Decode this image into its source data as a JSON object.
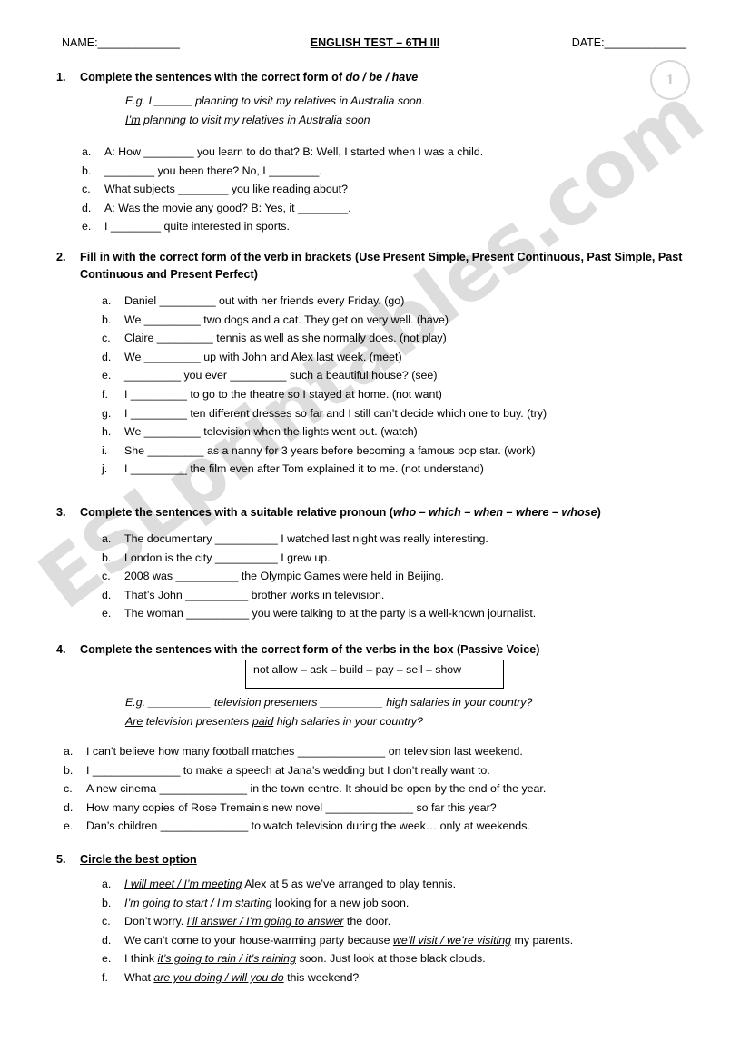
{
  "document": {
    "watermark": "ESLprintables.com",
    "page_badge": "1"
  },
  "header": {
    "name_label": "NAME:",
    "name_blank": "_____________",
    "title": "ENGLISH TEST – 6TH III",
    "date_label": "DATE:",
    "date_blank": "_____________"
  },
  "exercises": [
    {
      "number": "1.",
      "title_pre": "Complete the sentences with the correct form of ",
      "title_italic": "do / be / have",
      "example_prompt": "E.g. I ______ planning to visit my relatives in Australia soon.",
      "example_answer_underlined": "I’m",
      "example_answer_rest": " planning to visit my relatives in Australia soon",
      "items": [
        {
          "label": "a.",
          "text": "A: How ________ you learn to do that?       B: Well, I started when I was a child."
        },
        {
          "label": "b.",
          "text": "________ you been there? No, I ________."
        },
        {
          "label": "c.",
          "text": "What subjects ________ you like reading about?"
        },
        {
          "label": "d.",
          "text": "A: Was the movie any good?          B: Yes, it ________."
        },
        {
          "label": "e.",
          "text": "I ________ quite interested in sports."
        }
      ]
    },
    {
      "number": "2.",
      "title_pre": "Fill in with the correct form of the verb in brackets (Use Present Simple, Present Continuous, Past Simple, Past Continuous and Present Perfect)",
      "title_italic": "",
      "items": [
        {
          "label": "a.",
          "text": "Daniel _________ out with her friends every Friday. (go)"
        },
        {
          "label": "b.",
          "text": "We _________ two dogs and a cat. They get on very well. (have)"
        },
        {
          "label": "c.",
          "text": "Claire _________ tennis as well as she normally does. (not play)"
        },
        {
          "label": "d.",
          "text": "We _________ up with John and Alex last week. (meet)"
        },
        {
          "label": "e.",
          "text": "_________ you ever _________ such a beautiful house? (see)"
        },
        {
          "label": "f.",
          "text": "I _________ to go to the theatre so I stayed at home. (not want)"
        },
        {
          "label": "g.",
          "text": "I _________ ten different dresses so far and I still can’t decide which one to buy. (try)"
        },
        {
          "label": "h.",
          "text": "We _________ television when the lights went out. (watch)"
        },
        {
          "label": "i.",
          "text": "She _________ as a nanny for 3 years before becoming a famous pop star. (work)"
        },
        {
          "label": "j.",
          "text": "I _________ the film even after Tom explained it to me. (not understand)"
        }
      ]
    },
    {
      "number": "3.",
      "title_pre": "Complete the sentences with a suitable relative pronoun (",
      "title_italic": "who – which – when – where – whose",
      "title_post": ")",
      "items": [
        {
          "label": "a.",
          "text": "The documentary __________ I watched last night was really interesting."
        },
        {
          "label": "b.",
          "text": "London is the city __________ I grew up."
        },
        {
          "label": "c.",
          "text": "2008 was __________ the Olympic Games were held in Beijing."
        },
        {
          "label": "d.",
          "text": "That’s John __________ brother works in television."
        },
        {
          "label": "e.",
          "text": "The woman __________ you were talking to at the party is a well-known journalist."
        }
      ]
    },
    {
      "number": "4.",
      "title_pre": "Complete the sentences with the correct form of the verbs in the box (Passive Voice)",
      "title_italic": "",
      "verb_box": {
        "before_strike": "not allow – ask – build – ",
        "strike_word": "pay",
        "after_strike": " – sell – show"
      },
      "example_prompt": "E.g. __________ television presenters __________ high salaries in your country?",
      "example_answer_a": "Are",
      "example_answer_mid": " television presenters ",
      "example_answer_b": "paid",
      "example_answer_end": " high salaries in your country?",
      "items": [
        {
          "label": "a.",
          "text": "I can’t believe how many football matches ______________ on television last weekend."
        },
        {
          "label": "b.",
          "text": "I ______________ to make a speech at Jana’s wedding but I don’t really want to."
        },
        {
          "label": "c.",
          "text": "A new cinema ______________ in the town centre. It should be open by the end of the year."
        },
        {
          "label": "d.",
          "text": "How many copies of Rose Tremain’s new novel ______________ so far this year?"
        },
        {
          "label": "e.",
          "text": "Dan’s children ______________ to watch television during the week… only at weekends."
        }
      ]
    },
    {
      "number": "5.",
      "title_pre": "Circle the best option",
      "title_italic": "",
      "items": [
        {
          "label": "a.",
          "pre": "",
          "option": "I will meet / I’m meeting",
          "post": " Alex at 5 as we’ve arranged to play tennis."
        },
        {
          "label": "b.",
          "pre": "",
          "option": "I’m going to start / I’m starting",
          "post": " looking for a new job soon."
        },
        {
          "label": "c.",
          "pre": "Don’t worry. ",
          "option": "I’ll answer / I’m going to answer",
          "post": " the door."
        },
        {
          "label": "d.",
          "pre": "We can’t come to your house-warming party because ",
          "option": "we’ll visit / we’re visiting",
          "post": " my parents."
        },
        {
          "label": "e.",
          "pre": "I think ",
          "option": "it’s going to rain / it’s raining",
          "post": " soon. Just look at those black clouds."
        },
        {
          "label": "f.",
          "pre": "What ",
          "option": "are you doing / will you do",
          "post": " this weekend?"
        }
      ]
    }
  ]
}
